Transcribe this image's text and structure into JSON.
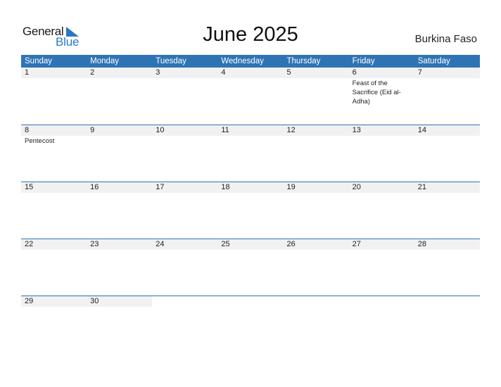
{
  "logo": {
    "general": "General",
    "blue": "Blue",
    "icon": "triangle-flag-icon",
    "accent": "#2a78c5"
  },
  "title": "June 2025",
  "country": "Burkina Faso",
  "colors": {
    "header": "#2e74b5",
    "date_row": "#f1f1f1"
  },
  "weekdays": [
    "Sunday",
    "Monday",
    "Tuesday",
    "Wednesday",
    "Thursday",
    "Friday",
    "Saturday"
  ],
  "weeks": [
    [
      {
        "day": "1",
        "event": ""
      },
      {
        "day": "2",
        "event": ""
      },
      {
        "day": "3",
        "event": ""
      },
      {
        "day": "4",
        "event": ""
      },
      {
        "day": "5",
        "event": ""
      },
      {
        "day": "6",
        "event": "Feast of the Sacrifice (Eid al-Adha)"
      },
      {
        "day": "7",
        "event": ""
      }
    ],
    [
      {
        "day": "8",
        "event": "Pentecost"
      },
      {
        "day": "9",
        "event": ""
      },
      {
        "day": "10",
        "event": ""
      },
      {
        "day": "11",
        "event": ""
      },
      {
        "day": "12",
        "event": ""
      },
      {
        "day": "13",
        "event": ""
      },
      {
        "day": "14",
        "event": ""
      }
    ],
    [
      {
        "day": "15",
        "event": ""
      },
      {
        "day": "16",
        "event": ""
      },
      {
        "day": "17",
        "event": ""
      },
      {
        "day": "18",
        "event": ""
      },
      {
        "day": "19",
        "event": ""
      },
      {
        "day": "20",
        "event": ""
      },
      {
        "day": "21",
        "event": ""
      }
    ],
    [
      {
        "day": "22",
        "event": ""
      },
      {
        "day": "23",
        "event": ""
      },
      {
        "day": "24",
        "event": ""
      },
      {
        "day": "25",
        "event": ""
      },
      {
        "day": "26",
        "event": ""
      },
      {
        "day": "27",
        "event": ""
      },
      {
        "day": "28",
        "event": ""
      }
    ],
    [
      {
        "day": "29",
        "event": ""
      },
      {
        "day": "30",
        "event": ""
      },
      {
        "day": "",
        "event": ""
      },
      {
        "day": "",
        "event": ""
      },
      {
        "day": "",
        "event": ""
      },
      {
        "day": "",
        "event": ""
      },
      {
        "day": "",
        "event": ""
      }
    ]
  ]
}
